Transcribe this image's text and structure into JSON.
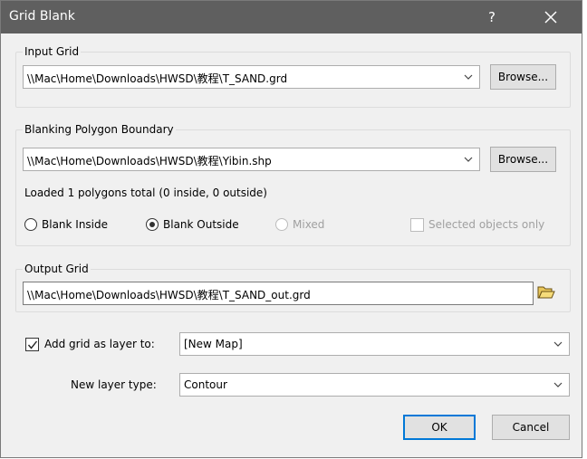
{
  "window": {
    "title": "Grid Blank",
    "help": "?"
  },
  "input_grid": {
    "label": "Input Grid",
    "value": "\\\\Mac\\Home\\Downloads\\HWSD\\教程\\T_SAND.grd",
    "browse_label": "Browse..."
  },
  "blanking": {
    "label": "Blanking Polygon Boundary",
    "value": "\\\\Mac\\Home\\Downloads\\HWSD\\教程\\Yibin.shp",
    "browse_label": "Browse...",
    "status": "Loaded 1 polygons total (0 inside, 0 outside)",
    "options": {
      "inside": "Blank Inside",
      "outside": "Blank Outside",
      "mixed": "Mixed",
      "selected_only": "Selected objects only"
    }
  },
  "output_grid": {
    "label": "Output Grid",
    "value": "\\\\Mac\\Home\\Downloads\\HWSD\\教程\\T_SAND_out.grd"
  },
  "add_layer": {
    "label": "Add grid as layer to:",
    "checked": true,
    "value": "[New Map]"
  },
  "layer_type": {
    "label": "New layer type:",
    "value": "Contour"
  },
  "buttons": {
    "ok": "OK",
    "cancel": "Cancel"
  }
}
